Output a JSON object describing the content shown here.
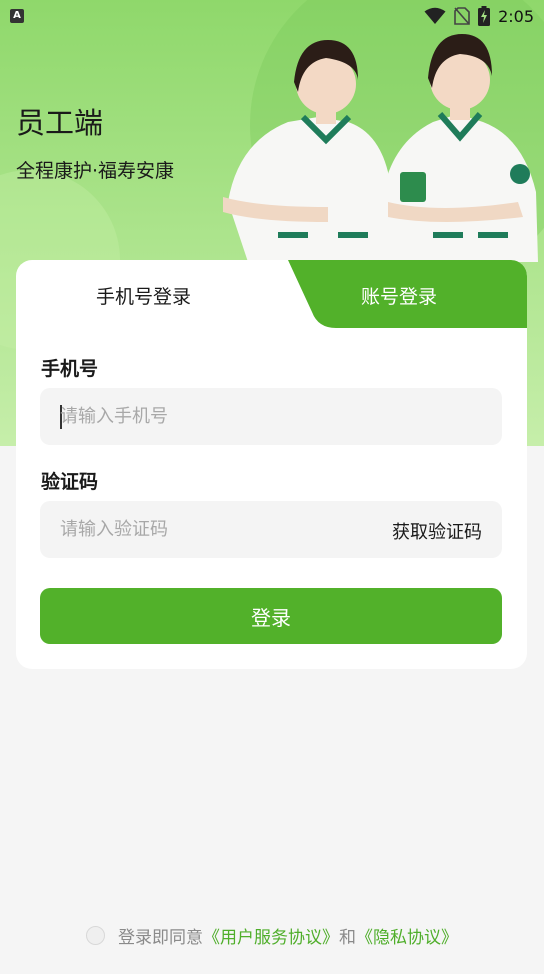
{
  "status_bar": {
    "notification_letter": "A",
    "time": "2:05"
  },
  "header": {
    "title": "员工端",
    "subtitle": "全程康护·福寿安康"
  },
  "tabs": [
    {
      "label": "手机号登录",
      "active": true
    },
    {
      "label": "账号登录",
      "active": false
    }
  ],
  "form": {
    "phone_label": "手机号",
    "phone_placeholder": "请输入手机号",
    "code_label": "验证码",
    "code_placeholder": "请输入验证码",
    "get_code_label": "获取验证码",
    "login_label": "登录"
  },
  "agreement": {
    "prefix": "登录即同意",
    "user_agreement": "《用户服务协议》",
    "and": "和",
    "privacy_agreement": "《隐私协议》"
  },
  "colors": {
    "brand_green": "#52b12a",
    "link_green": "#4fae2a",
    "hero_green": "#a5e184"
  }
}
